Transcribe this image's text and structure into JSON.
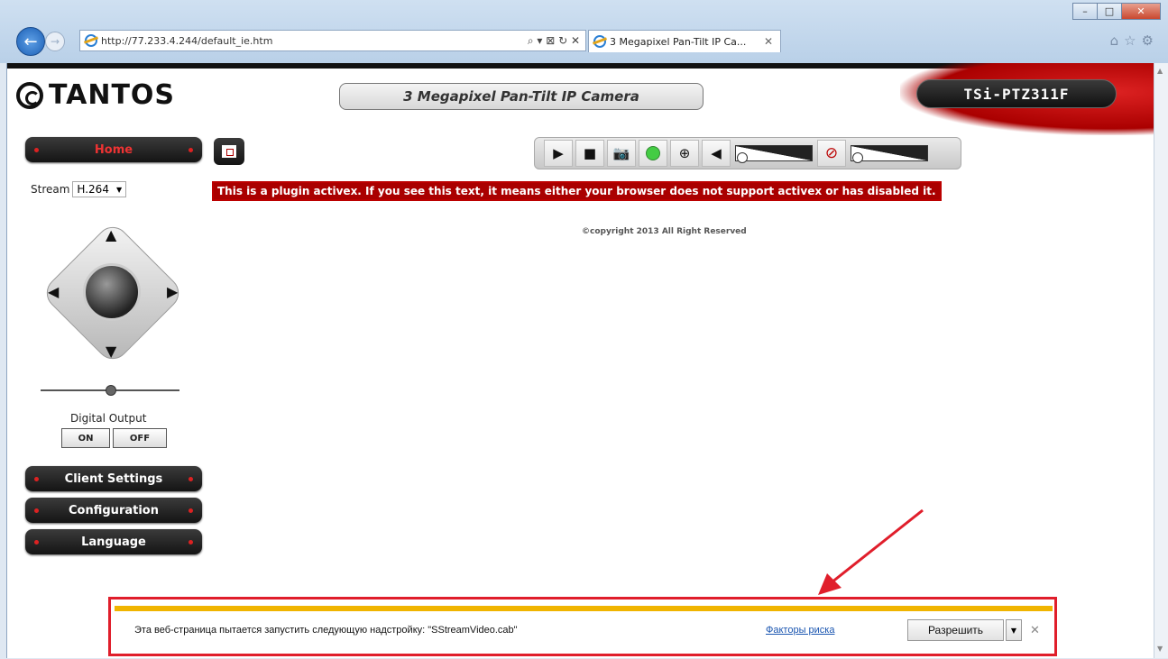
{
  "browser": {
    "url": "http://77.233.4.244/default_ie.htm",
    "address_tools": "⌕ ▾ ⊠ ↻ ✕",
    "tab_title": "3 Megapixel Pan-Tilt IP Ca...",
    "tab_close": "✕",
    "back": "←",
    "forward": "→",
    "right_tools": "⌂☆⚙",
    "win_min": "–",
    "win_max": "□",
    "win_close": "✕"
  },
  "header": {
    "logo": "TANTOS",
    "title": "3 Megapixel Pan-Tilt IP Camera",
    "model": "TSi-PTZ311F"
  },
  "nav": {
    "home": "Home",
    "client_settings": "Client Settings",
    "configuration": "Configuration",
    "language": "Language"
  },
  "stream": {
    "label": "Stream",
    "value": "H.264",
    "arrow": "▼"
  },
  "toolbar": {
    "play": "▶",
    "stop": "■",
    "snapshot": "📷",
    "zoom": "⊕",
    "speaker": "◀"
  },
  "ptz": {
    "up": "▲",
    "down": "▼",
    "left": "◀",
    "right": "▶"
  },
  "activex_message": "This is a plugin activex. If you see this text, it means either your browser does not support activex or has disabled it.",
  "copyright": "©copyright 2013 All Right Reserved",
  "digital_output": {
    "label": "Digital Output",
    "on": "ON",
    "off": "OFF"
  },
  "notification": {
    "message": "Эта веб-страница пытается запустить следующую надстройку: \"SStreamVideo.cab\"",
    "risk_link": "Факторы риска",
    "allow": "Разрешить",
    "dropdown": "▼",
    "close": "✕"
  },
  "colors": {
    "accent_red": "#e01e2b",
    "notify_bar": "#f0b400",
    "activex_bg": "#aa0000"
  }
}
